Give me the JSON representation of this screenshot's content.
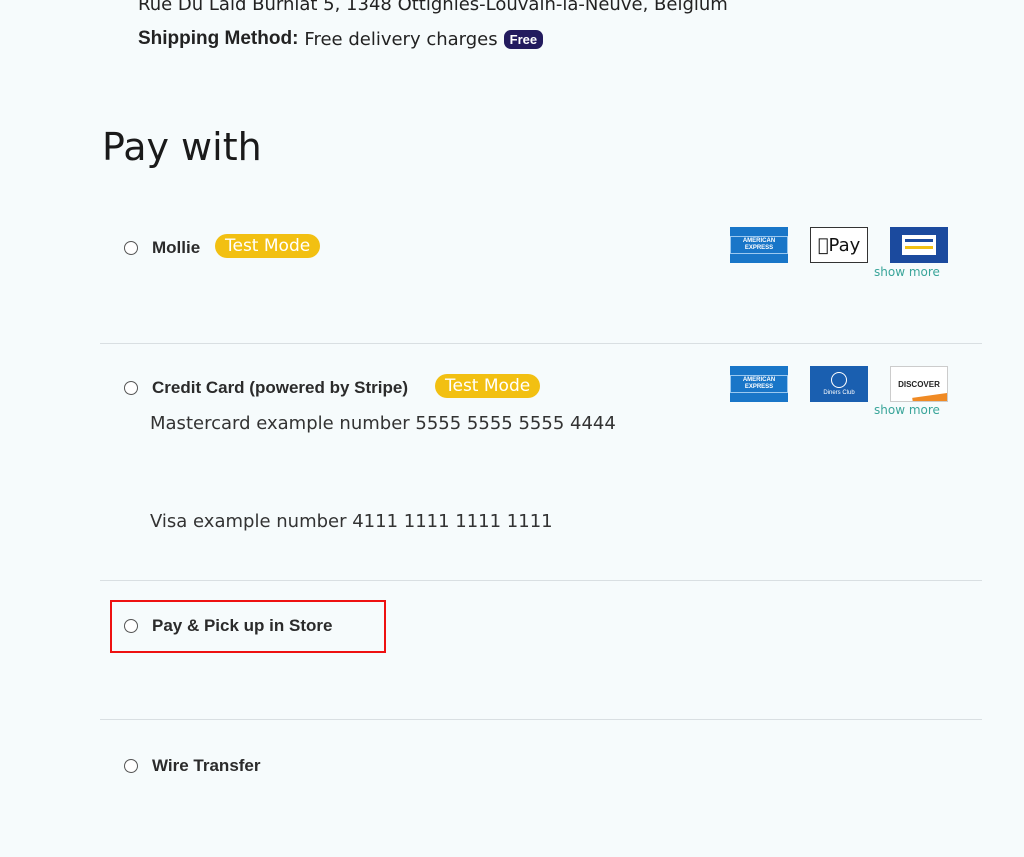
{
  "order": {
    "address": "Rue Du Laid Burniat 5, 1348 Ottignies-Louvain-la-Neuve, Belgium",
    "shipping_label": "Shipping Method:",
    "shipping_value": "Free delivery charges",
    "shipping_badge": "Free"
  },
  "payment": {
    "title": "Pay with",
    "show_more": "show more",
    "methods": [
      {
        "label": "Mollie",
        "badge": "Test Mode",
        "cards": [
          "amex-card-icon",
          "apple-pay-icon",
          "bancontact-card-icon"
        ]
      },
      {
        "label": "Credit Card (powered by Stripe)",
        "badge": "Test Mode",
        "cards": [
          "amex-card-icon",
          "diners-club-card-icon",
          "discover-card-icon"
        ],
        "descriptions": [
          "Mastercard example number 5555 5555 5555 4444",
          "Visa example number 4111 1111 1111 1111"
        ]
      },
      {
        "label": "Pay & Pick up in Store",
        "highlighted": true
      },
      {
        "label": "Wire Transfer"
      }
    ]
  },
  "card_texts": {
    "amex": "AMERICAN EXPRESS",
    "apple_pay": "Pay",
    "diners": "Diners Club",
    "discover": "DISCOVER"
  },
  "colors": {
    "test_badge": "#f2c012",
    "free_badge": "#231b5e",
    "highlight_border": "#ee1111",
    "show_more": "#3aa59a"
  }
}
